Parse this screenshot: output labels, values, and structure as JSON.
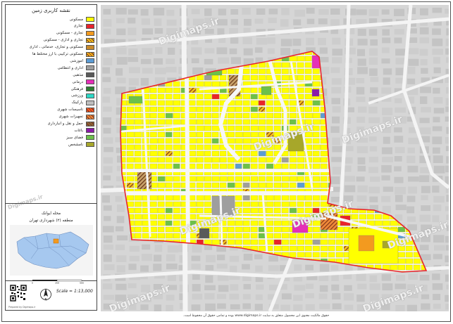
{
  "legend": {
    "title": "نقشه کاربری زمین",
    "items": [
      {
        "label": "مسکونی",
        "color": "#ffff00",
        "hatch": false,
        "icon": "residential-swatch"
      },
      {
        "label": "تجاری",
        "color": "#e8242c",
        "hatch": false,
        "icon": "commercial-swatch"
      },
      {
        "label": "تجاری - مسکونی",
        "color": "#f39a1f",
        "hatch": false,
        "icon": "commercial-residential-swatch"
      },
      {
        "label": "تجاری و اداری - مسکونی",
        "color": "#f5c518",
        "hatch": true,
        "icon": "commercial-office-residential-swatch"
      },
      {
        "label": "مسکونی و تجاری، خدماتی ، اداری",
        "color": "#c88a2c",
        "hatch": false,
        "icon": "mixed-service-swatch"
      },
      {
        "label": "مسکونی ترکیبی با ارز مختلط ها",
        "color": "#f3b51a",
        "hatch": true,
        "icon": "mixed-residential-swatch"
      },
      {
        "label": "آموزشی",
        "color": "#5b9bd5",
        "hatch": false,
        "icon": "educational-swatch"
      },
      {
        "label": "اداری و انتظامی",
        "color": "#9e9e9e",
        "hatch": false,
        "icon": "administrative-swatch"
      },
      {
        "label": "مذهبی",
        "color": "#5a5a5a",
        "hatch": false,
        "icon": "religious-swatch"
      },
      {
        "label": "درمانی",
        "color": "#e52fb8",
        "hatch": false,
        "icon": "medical-swatch"
      },
      {
        "label": "فرهنگی",
        "color": "#2e7d32",
        "hatch": false,
        "icon": "cultural-swatch"
      },
      {
        "label": "ورزشی",
        "color": "#2ed8c6",
        "hatch": false,
        "icon": "sports-swatch"
      },
      {
        "label": "پارکینگ",
        "color": "#bdbdbd",
        "hatch": false,
        "icon": "parking-swatch"
      },
      {
        "label": "تاسیسات شهری",
        "color": "#ff5a1f",
        "hatch": true,
        "icon": "urban-facilities-swatch"
      },
      {
        "label": "تجهیزات شهری",
        "color": "#f08a3a",
        "hatch": true,
        "icon": "urban-equipment-swatch"
      },
      {
        "label": "حمل و نقل و انبارداری",
        "color": "#8b6a3a",
        "hatch": true,
        "icon": "transport-swatch"
      },
      {
        "label": "باغات",
        "color": "#8b1aa8",
        "hatch": false,
        "icon": "gardens-swatch"
      },
      {
        "label": "فضای سبز",
        "color": "#6cc04a",
        "hatch": false,
        "icon": "green-space-swatch"
      },
      {
        "label": "نامشخص",
        "color": "#a7a72a",
        "hatch": false,
        "icon": "unknown-swatch"
      }
    ]
  },
  "location": {
    "name": "محله ایوانک",
    "district": "منطقه (۲) شهرداری تهران"
  },
  "scale_text": "Scale = 1:13,000",
  "north_label": "N",
  "scale_ticks": [
    "0",
    "250",
    "500"
  ],
  "watermark": "Digimaps.ir",
  "footnote": "Prepared by Digimaps.ir",
  "copyright": "حقوق مالکیت معنوی این محصول متعلق به سایت www.digimaps.ir بوده و تمامی حقوق آن محفوظ است.",
  "colors": {
    "residential": "#ffff00",
    "boundary": "#e8242c",
    "green": "#6cc04a",
    "basemap": "#d9d9d9",
    "road": "#f2f2f2"
  }
}
